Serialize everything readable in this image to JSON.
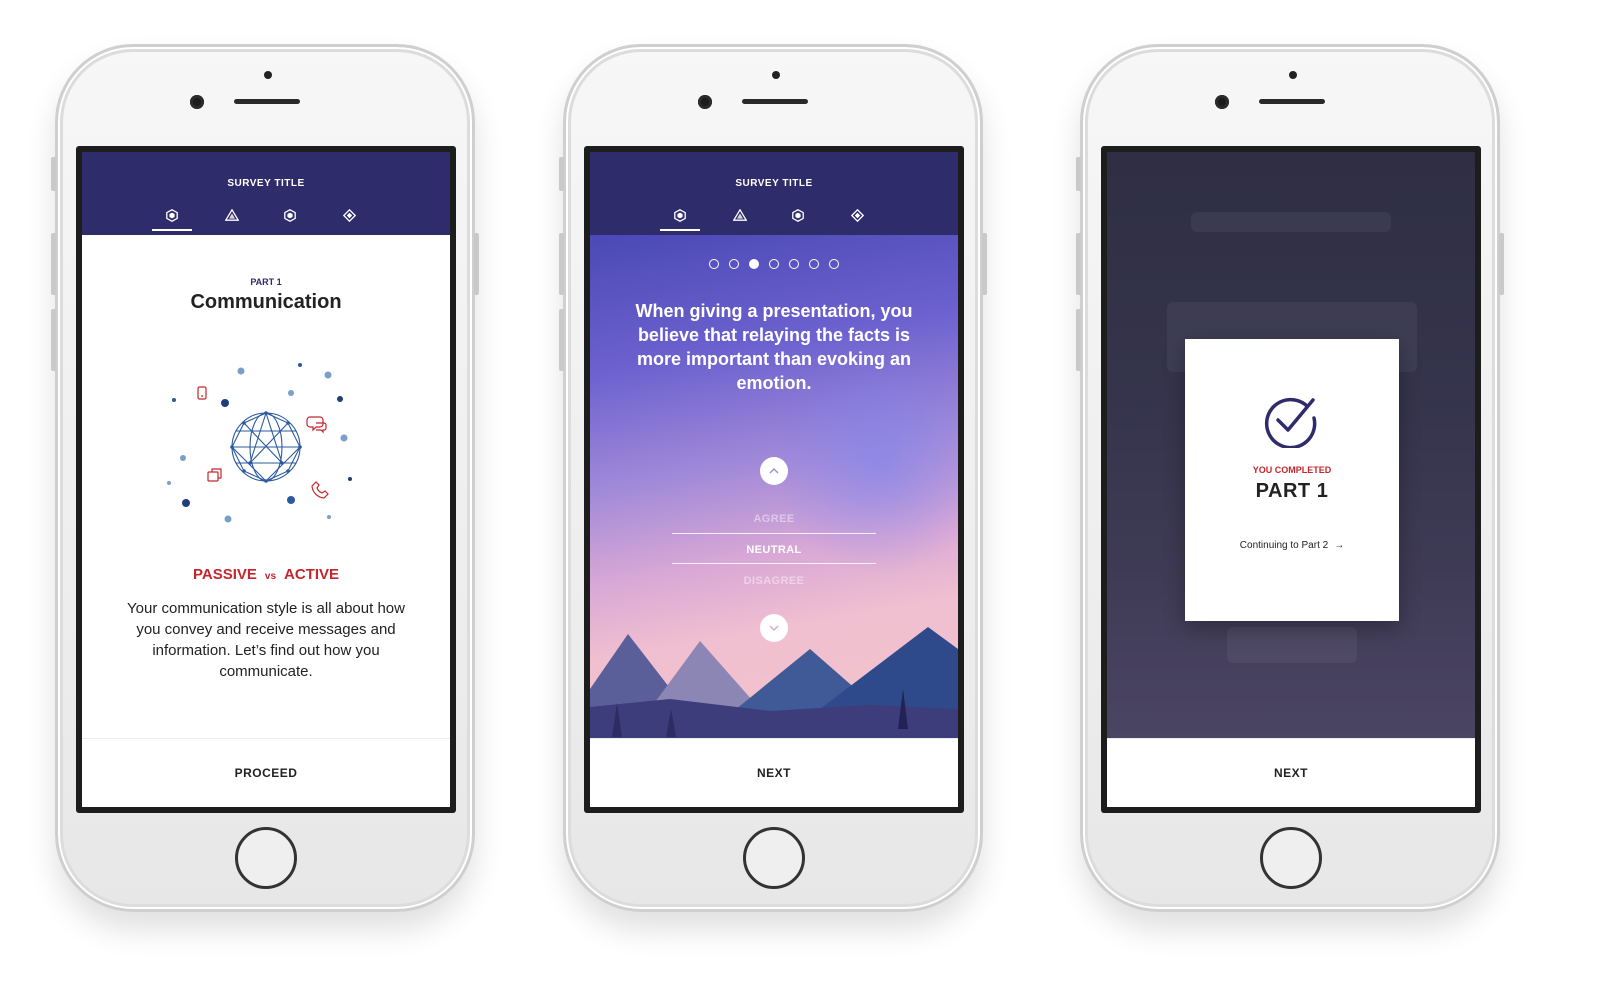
{
  "colors": {
    "navy": "#2f2c6b",
    "red": "#c3262d",
    "blue": "#2b5a9e"
  },
  "screen1": {
    "header_title": "SURVEY TITLE",
    "tabs": [
      "hexagon-icon",
      "triangle-icon",
      "hexagon-icon",
      "diamond-icon"
    ],
    "part_label": "PART 1",
    "part_title": "Communication",
    "passive": "PASSIVE",
    "vs": "vs",
    "active": "ACTIVE",
    "description": "Your communication style is all about how you convey and receive messages and information. Let’s find out how you communicate.",
    "button": "PROCEED"
  },
  "screen2": {
    "header_title": "SURVEY TITLE",
    "progress": {
      "total": 7,
      "current": 3
    },
    "question": "When giving a presentation, you believe that relaying the facts is more important than evoking an emotion.",
    "options": {
      "above": "AGREE",
      "selected": "NEUTRAL",
      "below": "DISAGREE"
    },
    "button": "NEXT"
  },
  "screen3": {
    "you_completed": "YOU COMPLETED",
    "part": "PART 1",
    "continuing": "Continuing to Part 2",
    "arrow": "→",
    "button": "NEXT"
  }
}
